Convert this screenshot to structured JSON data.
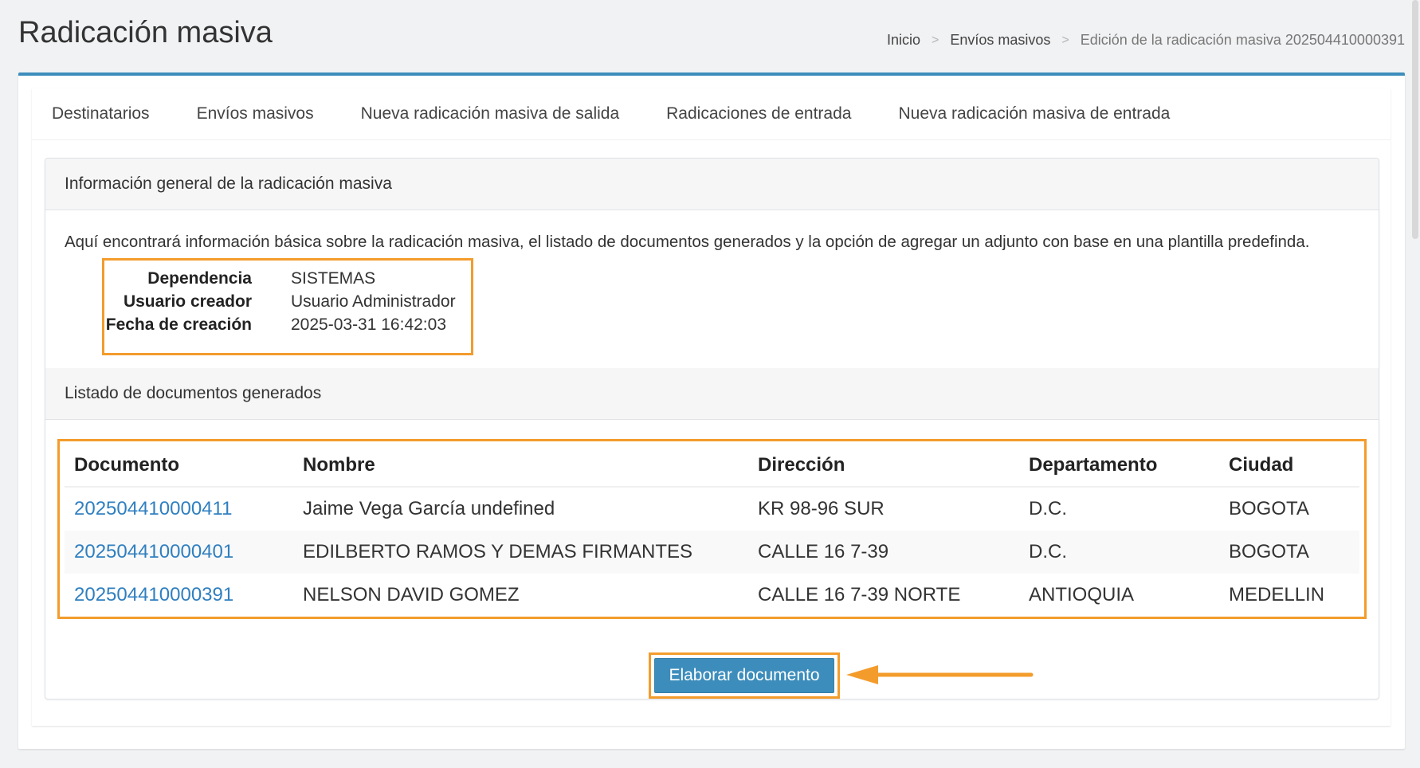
{
  "header": {
    "title": "Radicación masiva",
    "breadcrumb": [
      "Inicio",
      "Envíos masivos",
      "Edición de la radicación masiva 202504410000391"
    ]
  },
  "tabs": [
    "Destinatarios",
    "Envíos masivos",
    "Nueva radicación masiva de salida",
    "Radicaciones de entrada",
    "Nueva radicación masiva de entrada"
  ],
  "general": {
    "heading": "Información general de la radicación masiva",
    "intro": "Aquí encontrará información básica sobre la radicación masiva, el listado de documentos generados y la opción de agregar un adjunto con base en una plantilla predefinda.",
    "fields": [
      {
        "label": "Dependencia",
        "value": "SISTEMAS"
      },
      {
        "label": "Usuario creador",
        "value": "Usuario Administrador"
      },
      {
        "label": "Fecha de creación",
        "value": "2025-03-31 16:42:03"
      }
    ]
  },
  "documents": {
    "heading": "Listado de documentos generados",
    "columns": [
      "Documento",
      "Nombre",
      "Dirección",
      "Departamento",
      "Ciudad"
    ],
    "rows": [
      [
        "202504410000411",
        "Jaime Vega García undefined",
        "KR 98-96 SUR",
        "D.C.",
        "BOGOTA"
      ],
      [
        "202504410000401",
        "EDILBERTO RAMOS Y DEMAS FIRMANTES",
        "CALLE 16 7-39",
        "D.C.",
        "BOGOTA"
      ],
      [
        "202504410000391",
        "NELSON DAVID GOMEZ",
        "CALLE 16 7-39 NORTE",
        "ANTIOQUIA",
        "MEDELLIN"
      ]
    ]
  },
  "action": {
    "button_label": "Elaborar documento"
  },
  "colors": {
    "accent": "#3c8dbc",
    "highlight": "#f39c2c",
    "link": "#2f7fc0"
  }
}
